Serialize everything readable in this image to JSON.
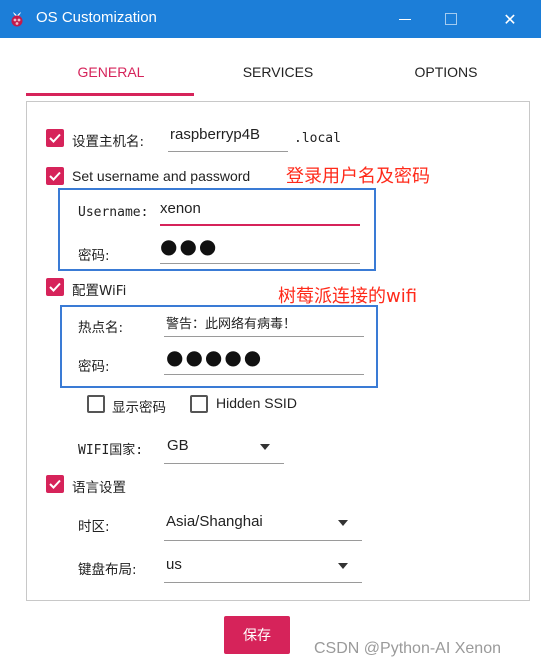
{
  "window": {
    "title": "OS Customization",
    "titlebar_color": "#1c7ed8",
    "close_glyph": "✕"
  },
  "tabs": [
    {
      "label": "GENERAL",
      "active": true
    },
    {
      "label": "SERVICES",
      "active": false
    },
    {
      "label": "OPTIONS",
      "active": false
    }
  ],
  "accent_color": "#d6235a",
  "general": {
    "hostname": {
      "checked": true,
      "label": "设置主机名:",
      "value": "raspberryp4B",
      "suffix": ".local"
    },
    "user": {
      "checked": true,
      "label": "Set username and password",
      "username_label": "Username:",
      "username_value": "xenon",
      "password_label": "密码:",
      "password_mask": "●●●"
    },
    "wifi": {
      "checked": true,
      "label": "配置WiFi",
      "ssid_label": "热点名:",
      "ssid_value": "警告：此网络有病毒！",
      "password_label": "密码:",
      "password_mask": "●●●●●",
      "show_password": {
        "checked": false,
        "label": "显示密码"
      },
      "hidden_ssid": {
        "checked": false,
        "label": "Hidden SSID"
      },
      "country_label": "WIFI国家:",
      "country_value": "GB"
    },
    "locale": {
      "checked": true,
      "label": "语言设置",
      "timezone_label": "时区:",
      "timezone_value": "Asia/Shanghai",
      "keyboard_label": "键盘布局:",
      "keyboard_value": "us"
    }
  },
  "annotations": {
    "user_note": "登录用户名及密码",
    "wifi_note": "树莓派连接的wifi",
    "color": "#ff2a1a"
  },
  "save_label": "保存",
  "watermark": "CSDN @Python-AI Xenon"
}
